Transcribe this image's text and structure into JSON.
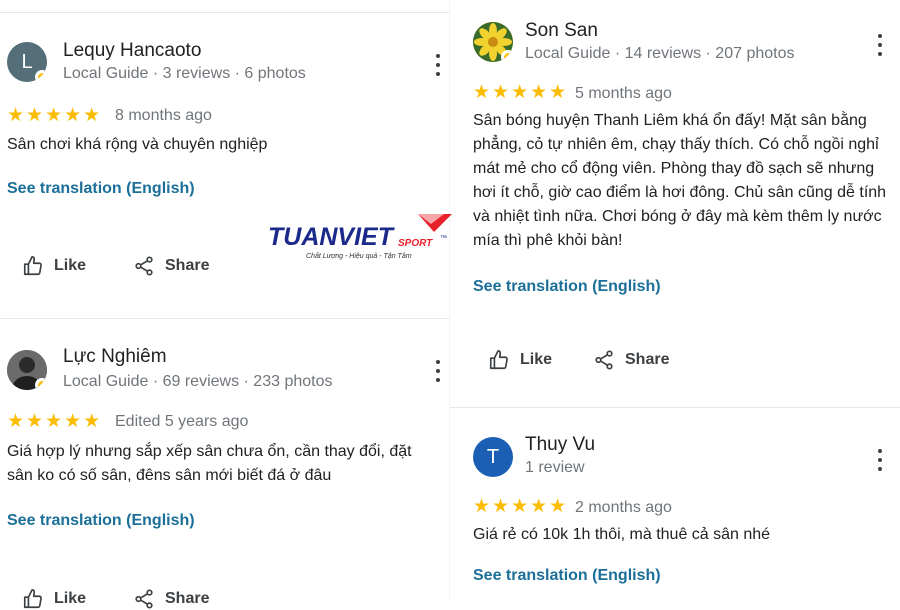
{
  "reviews": [
    {
      "name": "Lequy Hancaoto",
      "avatar_letter": "L",
      "avatar_color": "#546e7a",
      "meta": "Local Guide · 3 reviews · 6 photos",
      "stars": "★★★★★",
      "date": "8 months ago",
      "text": "Sân chơi khá rộng và chuyên nghiệp",
      "translate": "See translation (English)",
      "like": "Like",
      "share": "Share"
    },
    {
      "name": "Lực Nghiêm",
      "avatar_letter": "",
      "avatar_color": "#5f6368",
      "meta": "Local Guide · 69 reviews · 233 photos",
      "stars": "★★★★★",
      "date": "Edited 5 years ago",
      "text": "Giá hợp lý nhưng sắp xếp sân chưa ổn, cần thay đổi, đặt sân ko có số sân, đêns sân mới biết đá ở đâu",
      "translate": "See translation (English)",
      "like": "Like",
      "share": "Share"
    },
    {
      "name": "Son San",
      "avatar_letter": "",
      "avatar_color": "#e8c62a",
      "meta": "Local Guide · 14 reviews · 207 photos",
      "stars": "★★★★★",
      "date": "5 months ago",
      "text": "Sân bóng huyện Thanh Liêm khá ổn đấy! Mặt sân bằng phẳng, cỏ tự nhiên êm, chạy thấy thích. Có chỗ ngồi nghỉ mát mẻ cho cổ động viên. Phòng thay đồ sạch sẽ nhưng hơi ít chỗ, giờ cao điểm là hơi đông. Chủ sân cũng dễ tính và nhiệt tình nữa. Chơi bóng ở đây mà kèm thêm ly nước mía thì phê khỏi bàn!",
      "translate": "See translation (English)",
      "like": "Like",
      "share": "Share"
    },
    {
      "name": "Thuy Vu",
      "avatar_letter": "T",
      "avatar_color": "#1a5fb4",
      "meta": "1 review",
      "stars": "★★★★★",
      "date": "2 months ago",
      "text": "Giá rẻ có 10k 1h thôi, mà thuê cả sân nhé",
      "translate": "See translation (English)"
    }
  ],
  "logo": {
    "brand": "TUANVIET",
    "suffix": "SPORT",
    "tm": "™",
    "tagline": "Chất Lượng - Hiệu quả - Tận Tâm",
    "brand_color": "#1b2a8a",
    "accent_color": "#e8202a"
  }
}
